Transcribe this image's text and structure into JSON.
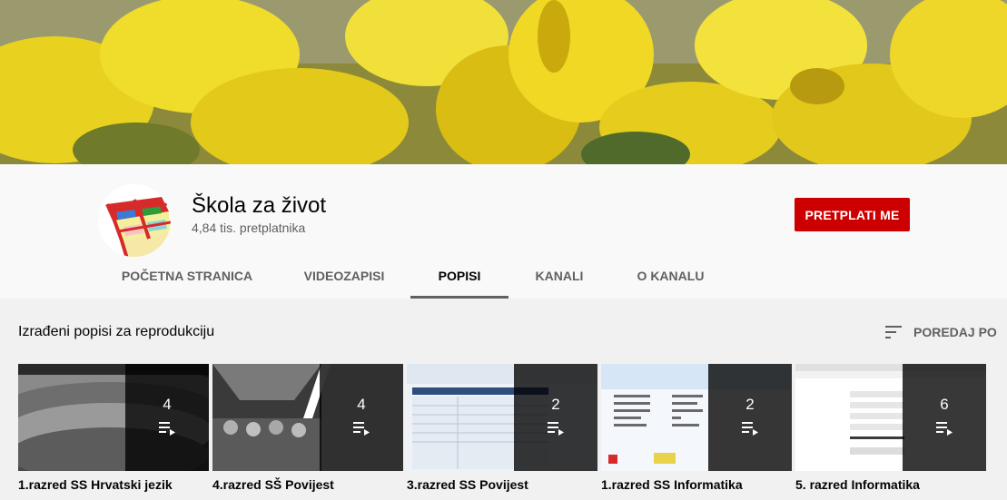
{
  "channel": {
    "name": "Škola za život",
    "subscribers": "4,84 tis. pretplatnika",
    "subscribe_label": "PRETPLATI ME"
  },
  "tabs": [
    {
      "label": "POČETNA STRANICA"
    },
    {
      "label": "VIDEOZAPISI"
    },
    {
      "label": "POPISI",
      "active": true
    },
    {
      "label": "KANALI"
    },
    {
      "label": "O KANALU"
    }
  ],
  "section": {
    "title": "Izrađeni popisi za reprodukciju",
    "sort_label": "POREDAJ PO"
  },
  "playlists": [
    {
      "title": "1.razred SS Hrvatski jezik",
      "count": "4"
    },
    {
      "title": "4.razred SŠ Povijest",
      "count": "4"
    },
    {
      "title": "3.razred SS Povijest",
      "count": "2"
    },
    {
      "title": "1.razred SS Informatika",
      "count": "2"
    },
    {
      "title": "5. razred Informatika",
      "count": "6"
    }
  ],
  "colors": {
    "subscribe_bg": "#cc0000",
    "active_tab_underline": "#606060",
    "content_bg": "#f1f1f1"
  }
}
